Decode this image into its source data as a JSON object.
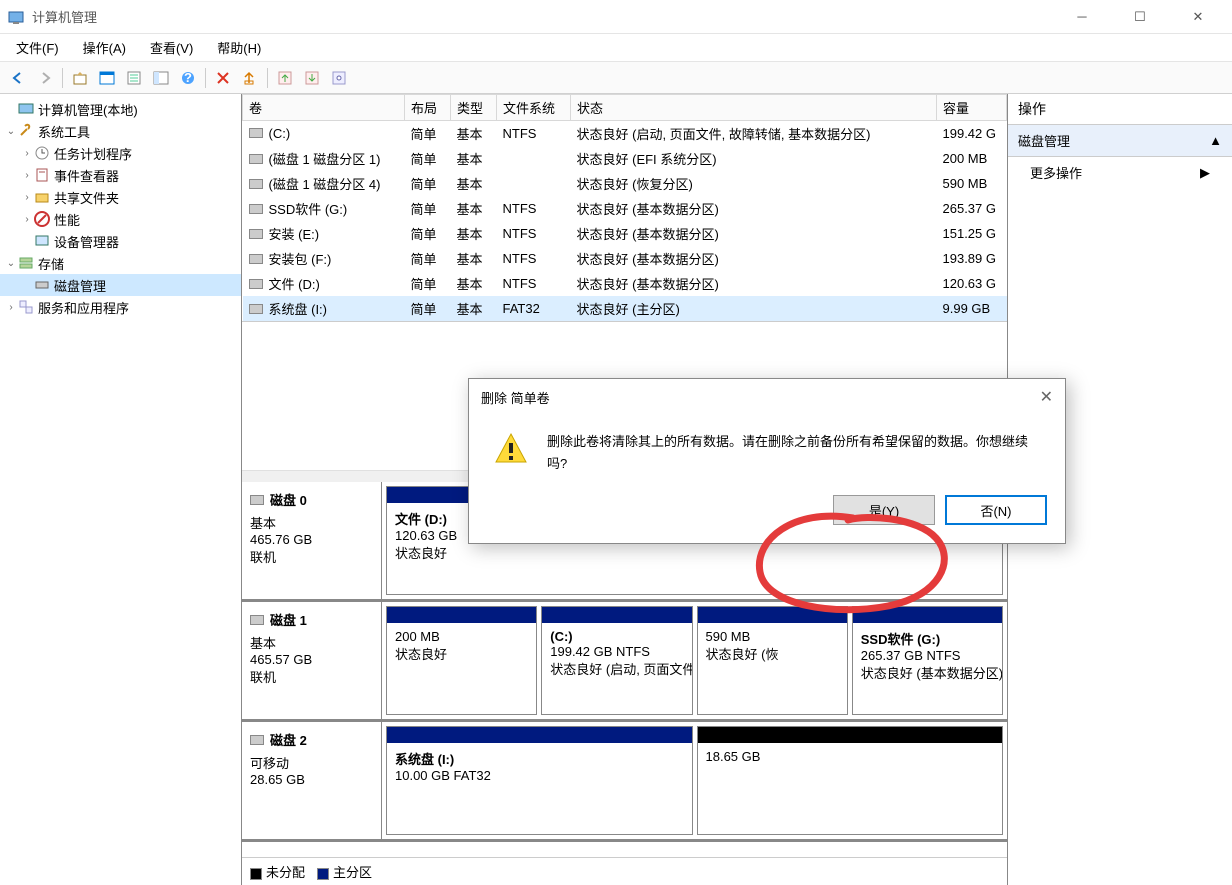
{
  "window": {
    "title": "计算机管理"
  },
  "menubar": {
    "file": "文件(F)",
    "action": "操作(A)",
    "view": "查看(V)",
    "help": "帮助(H)"
  },
  "tree": {
    "root": "计算机管理(本地)",
    "system_tools": "系统工具",
    "task_scheduler": "任务计划程序",
    "event_viewer": "事件查看器",
    "shared_folders": "共享文件夹",
    "performance": "性能",
    "device_manager": "设备管理器",
    "storage": "存储",
    "disk_management": "磁盘管理",
    "services": "服务和应用程序"
  },
  "columns": {
    "volume": "卷",
    "layout": "布局",
    "type": "类型",
    "fs": "文件系统",
    "status": "状态",
    "capacity": "容量"
  },
  "volumes": [
    {
      "name": "(C:)",
      "layout": "简单",
      "type": "基本",
      "fs": "NTFS",
      "status": "状态良好 (启动, 页面文件, 故障转储, 基本数据分区)",
      "capacity": "199.42 G"
    },
    {
      "name": "(磁盘 1 磁盘分区 1)",
      "layout": "简单",
      "type": "基本",
      "fs": "",
      "status": "状态良好 (EFI 系统分区)",
      "capacity": "200 MB"
    },
    {
      "name": "(磁盘 1 磁盘分区 4)",
      "layout": "简单",
      "type": "基本",
      "fs": "",
      "status": "状态良好 (恢复分区)",
      "capacity": "590 MB"
    },
    {
      "name": "SSD软件 (G:)",
      "layout": "简单",
      "type": "基本",
      "fs": "NTFS",
      "status": "状态良好 (基本数据分区)",
      "capacity": "265.37 G"
    },
    {
      "name": "安装 (E:)",
      "layout": "简单",
      "type": "基本",
      "fs": "NTFS",
      "status": "状态良好 (基本数据分区)",
      "capacity": "151.25 G"
    },
    {
      "name": "安装包 (F:)",
      "layout": "简单",
      "type": "基本",
      "fs": "NTFS",
      "status": "状态良好 (基本数据分区)",
      "capacity": "193.89 G"
    },
    {
      "name": "文件 (D:)",
      "layout": "简单",
      "type": "基本",
      "fs": "NTFS",
      "status": "状态良好 (基本数据分区)",
      "capacity": "120.63 G"
    },
    {
      "name": "系统盘 (I:)",
      "layout": "简单",
      "type": "基本",
      "fs": "FAT32",
      "status": "状态良好 (主分区)",
      "capacity": "9.99 GB"
    }
  ],
  "disks": [
    {
      "name": "磁盘 0",
      "kind": "基本",
      "size": "465.76 GB",
      "state": "联机",
      "parts": [
        {
          "title": "文件  (D:)",
          "line1": "120.63 GB",
          "line2": "状态良好"
        }
      ]
    },
    {
      "name": "磁盘 1",
      "kind": "基本",
      "size": "465.57 GB",
      "state": "联机",
      "parts": [
        {
          "title": "",
          "line1": "200 MB",
          "line2": "状态良好"
        },
        {
          "title": "(C:)",
          "line1": "199.42 GB NTFS",
          "line2": "状态良好 (启动, 页面文件,"
        },
        {
          "title": "",
          "line1": "590 MB",
          "line2": "状态良好 (恢"
        },
        {
          "title": "SSD软件  (G:)",
          "line1": "265.37 GB NTFS",
          "line2": "状态良好 (基本数据分区)"
        }
      ]
    },
    {
      "name": "磁盘 2",
      "kind": "可移动",
      "size": "28.65 GB",
      "state": "",
      "parts": [
        {
          "title": "系统盘  (I:)",
          "line1": "10.00 GB FAT32",
          "line2": ""
        },
        {
          "title": "",
          "line1": "18.65 GB",
          "line2": "",
          "unalloc": true
        }
      ]
    }
  ],
  "legend": {
    "unalloc": "未分配",
    "primary": "主分区"
  },
  "actions": {
    "header": "操作",
    "section": "磁盘管理",
    "more": "更多操作"
  },
  "dialog": {
    "title": "删除 简单卷",
    "message": "删除此卷将清除其上的所有数据。请在删除之前备份所有希望保留的数据。你想继续吗?",
    "yes": "是(Y)",
    "no": "否(N)"
  }
}
